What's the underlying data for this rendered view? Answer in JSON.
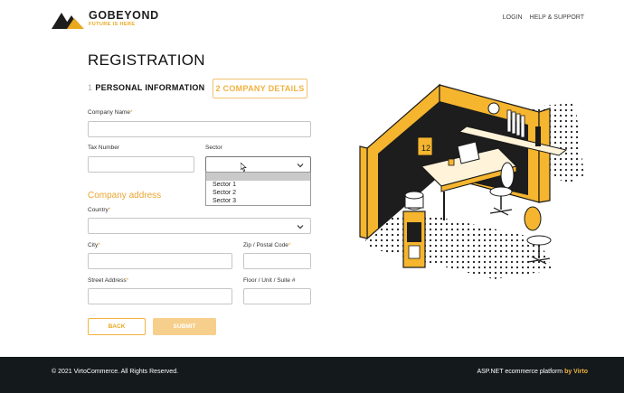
{
  "header": {
    "brand": "GOBEYOND",
    "tagline": "FUTURE IS HERE",
    "nav": {
      "login": "LOGIN",
      "help": "HELP & SUPPORT"
    }
  },
  "page": {
    "title": "REGISTRATION",
    "steps": [
      {
        "number": "1",
        "label": "PERSONAL INFORMATION",
        "active": true
      },
      {
        "label": "2 COMPANY DETAILS",
        "active": false
      }
    ]
  },
  "form": {
    "company_name": {
      "label": "Company Name",
      "required": "*",
      "value": ""
    },
    "tax_number": {
      "label": "Tax Number",
      "value": ""
    },
    "sector": {
      "label": "Sector",
      "value": "",
      "options": [
        "Sector 1",
        "Sector 2",
        "Sector 3"
      ],
      "open": true
    },
    "company_address_title": "Company address",
    "country": {
      "label": "Country",
      "required": "*",
      "value": ""
    },
    "city": {
      "label": "City",
      "required": "*",
      "value": ""
    },
    "zip": {
      "label": "Zip / Postal Code",
      "required": "*",
      "value": ""
    },
    "street": {
      "label": "Street Address",
      "required": "*",
      "value": ""
    },
    "floor": {
      "label": "Floor / Unit / Suite #",
      "value": ""
    },
    "back_label": "BACK",
    "submit_label": "SUBMIT"
  },
  "illustration": {
    "calendar_number": "12",
    "icon": "office-cubicle-illustration"
  },
  "footer": {
    "copyright": "© 2021 VirtoCommerce. All Rights Reserved.",
    "platform_text": "ASP.NET ecommerce platform ",
    "platform_link": "by Virto"
  },
  "colors": {
    "accent": "#e9a81e",
    "accent_light": "#f7cf8d",
    "footer_bg": "#14191c"
  }
}
